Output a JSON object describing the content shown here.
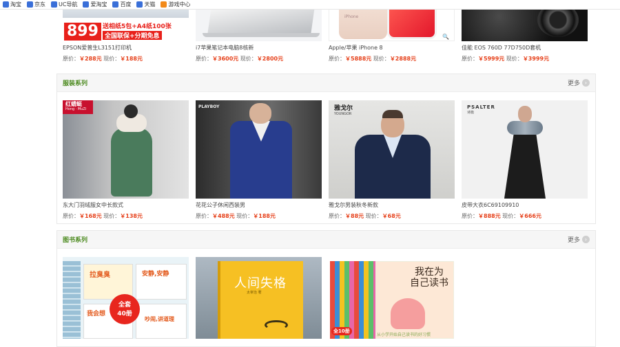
{
  "bookmarks": [
    {
      "label": "淘宝",
      "icon": "bookmark-icon"
    },
    {
      "label": "京东",
      "icon": "bookmark-icon"
    },
    {
      "label": "UC导航",
      "icon": "bookmark-icon"
    },
    {
      "label": "爱淘宝",
      "icon": "bookmark-icon"
    },
    {
      "label": "百度",
      "icon": "bookmark-icon"
    },
    {
      "label": "天猫",
      "icon": "bookmark-icon"
    },
    {
      "label": "游戏中心",
      "icon": "game-icon"
    }
  ],
  "top_row": [
    {
      "name": "EPSON爱普生L3151打印机",
      "orig_label": "原价：",
      "orig": "￥288元",
      "now_label": "现价：",
      "now": "￥188元",
      "promo": {
        "price": "899",
        "line1": "送相纸5包+A4纸100张",
        "line2": "全国联保+分期免息"
      }
    },
    {
      "name": "i7苹果笔记本电脑8核新",
      "orig_label": "原价：",
      "orig": "￥3600元",
      "now_label": "现价：",
      "now": "￥2800元"
    },
    {
      "name": "Apple/苹果 iPhone 8",
      "orig_label": "原价：",
      "orig": "￥5888元",
      "now_label": "现价：",
      "now": "￥2888元",
      "phone_text": "iPhone"
    },
    {
      "name": "佳能 EOS 760D 77D750D套机",
      "orig_label": "原价：",
      "orig": "￥5999元",
      "now_label": "现价：",
      "now": "￥3999元"
    }
  ],
  "clothing": {
    "title": "服装系列",
    "more": "更多",
    "items": [
      {
        "name": "东大门羽绒服女中长款式",
        "orig_label": "原价：",
        "orig": "￥168元",
        "now_label": "现价：",
        "now": "￥138元",
        "brand": "红蜻蜓",
        "brand_sub": "Hong · MuZi"
      },
      {
        "name": "花花公子休闲西装男",
        "orig_label": "原价：",
        "orig": "￥488元",
        "now_label": "现价：",
        "now": "￥188元",
        "brand": "PLAYBOY"
      },
      {
        "name": "雅戈尔男装秋冬新款",
        "orig_label": "原价：",
        "orig": "￥88元",
        "now_label": "现价：",
        "now": "￥68元",
        "brand": "雅戈尔",
        "brand_sub": "YOUNGOR"
      },
      {
        "name": "皮带大衣6C69109910",
        "orig_label": "原价：",
        "orig": "￥888元",
        "now_label": "现价：",
        "now": "￥666元",
        "brand": "PSALTER",
        "brand_sub": "诗篇"
      }
    ]
  },
  "books": {
    "title": "图书系列",
    "more": "更多",
    "items": [
      {
        "cover1": "拉臭臭",
        "cover2": "安静,安静",
        "cover3": "我会想",
        "cover4": "吵闹,讲道理",
        "badge_l1": "全套",
        "badge_l2": "40册"
      },
      {
        "cover_title": "人间失格",
        "cover_sub": "太宰治 著"
      },
      {
        "cover_title_l1": "我在为",
        "cover_title_l2": "自己读书",
        "cover_sub": "从小学开始自己读书的好习惯",
        "badge": "全10册"
      }
    ]
  },
  "colors": {
    "accent_green": "#4c8a1f",
    "price_red": "#e6411b"
  }
}
